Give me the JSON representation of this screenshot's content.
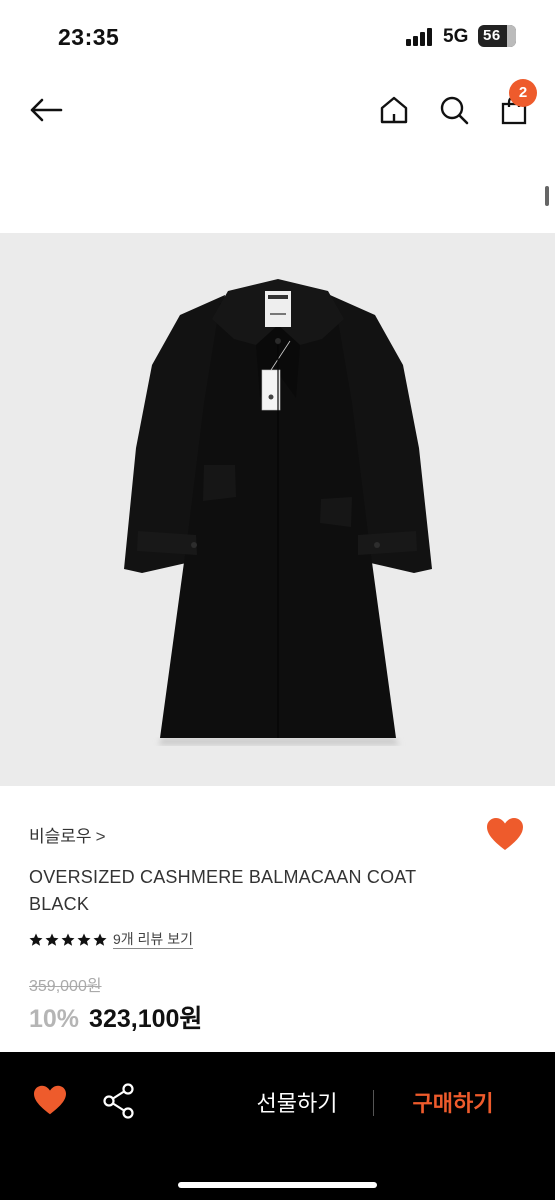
{
  "status_bar": {
    "time": "23:35",
    "network": "5G",
    "battery": "56"
  },
  "nav": {
    "cart_count": "2"
  },
  "product": {
    "brand": "비슬로우",
    "brand_chevron": ">",
    "name": "OVERSIZED CASHMERE BALMACAAN COAT BLACK",
    "rating_stars": 5,
    "review_link": "9개 리뷰 보기",
    "original_price": "359,000원",
    "discount": "10%",
    "sale_price": "323,100원"
  },
  "bottom_bar": {
    "gift_label": "선물하기",
    "buy_label": "구매하기"
  },
  "colors": {
    "accent": "#ee5b2c",
    "bar": "#000000",
    "image_bg": "#ebebeb"
  }
}
